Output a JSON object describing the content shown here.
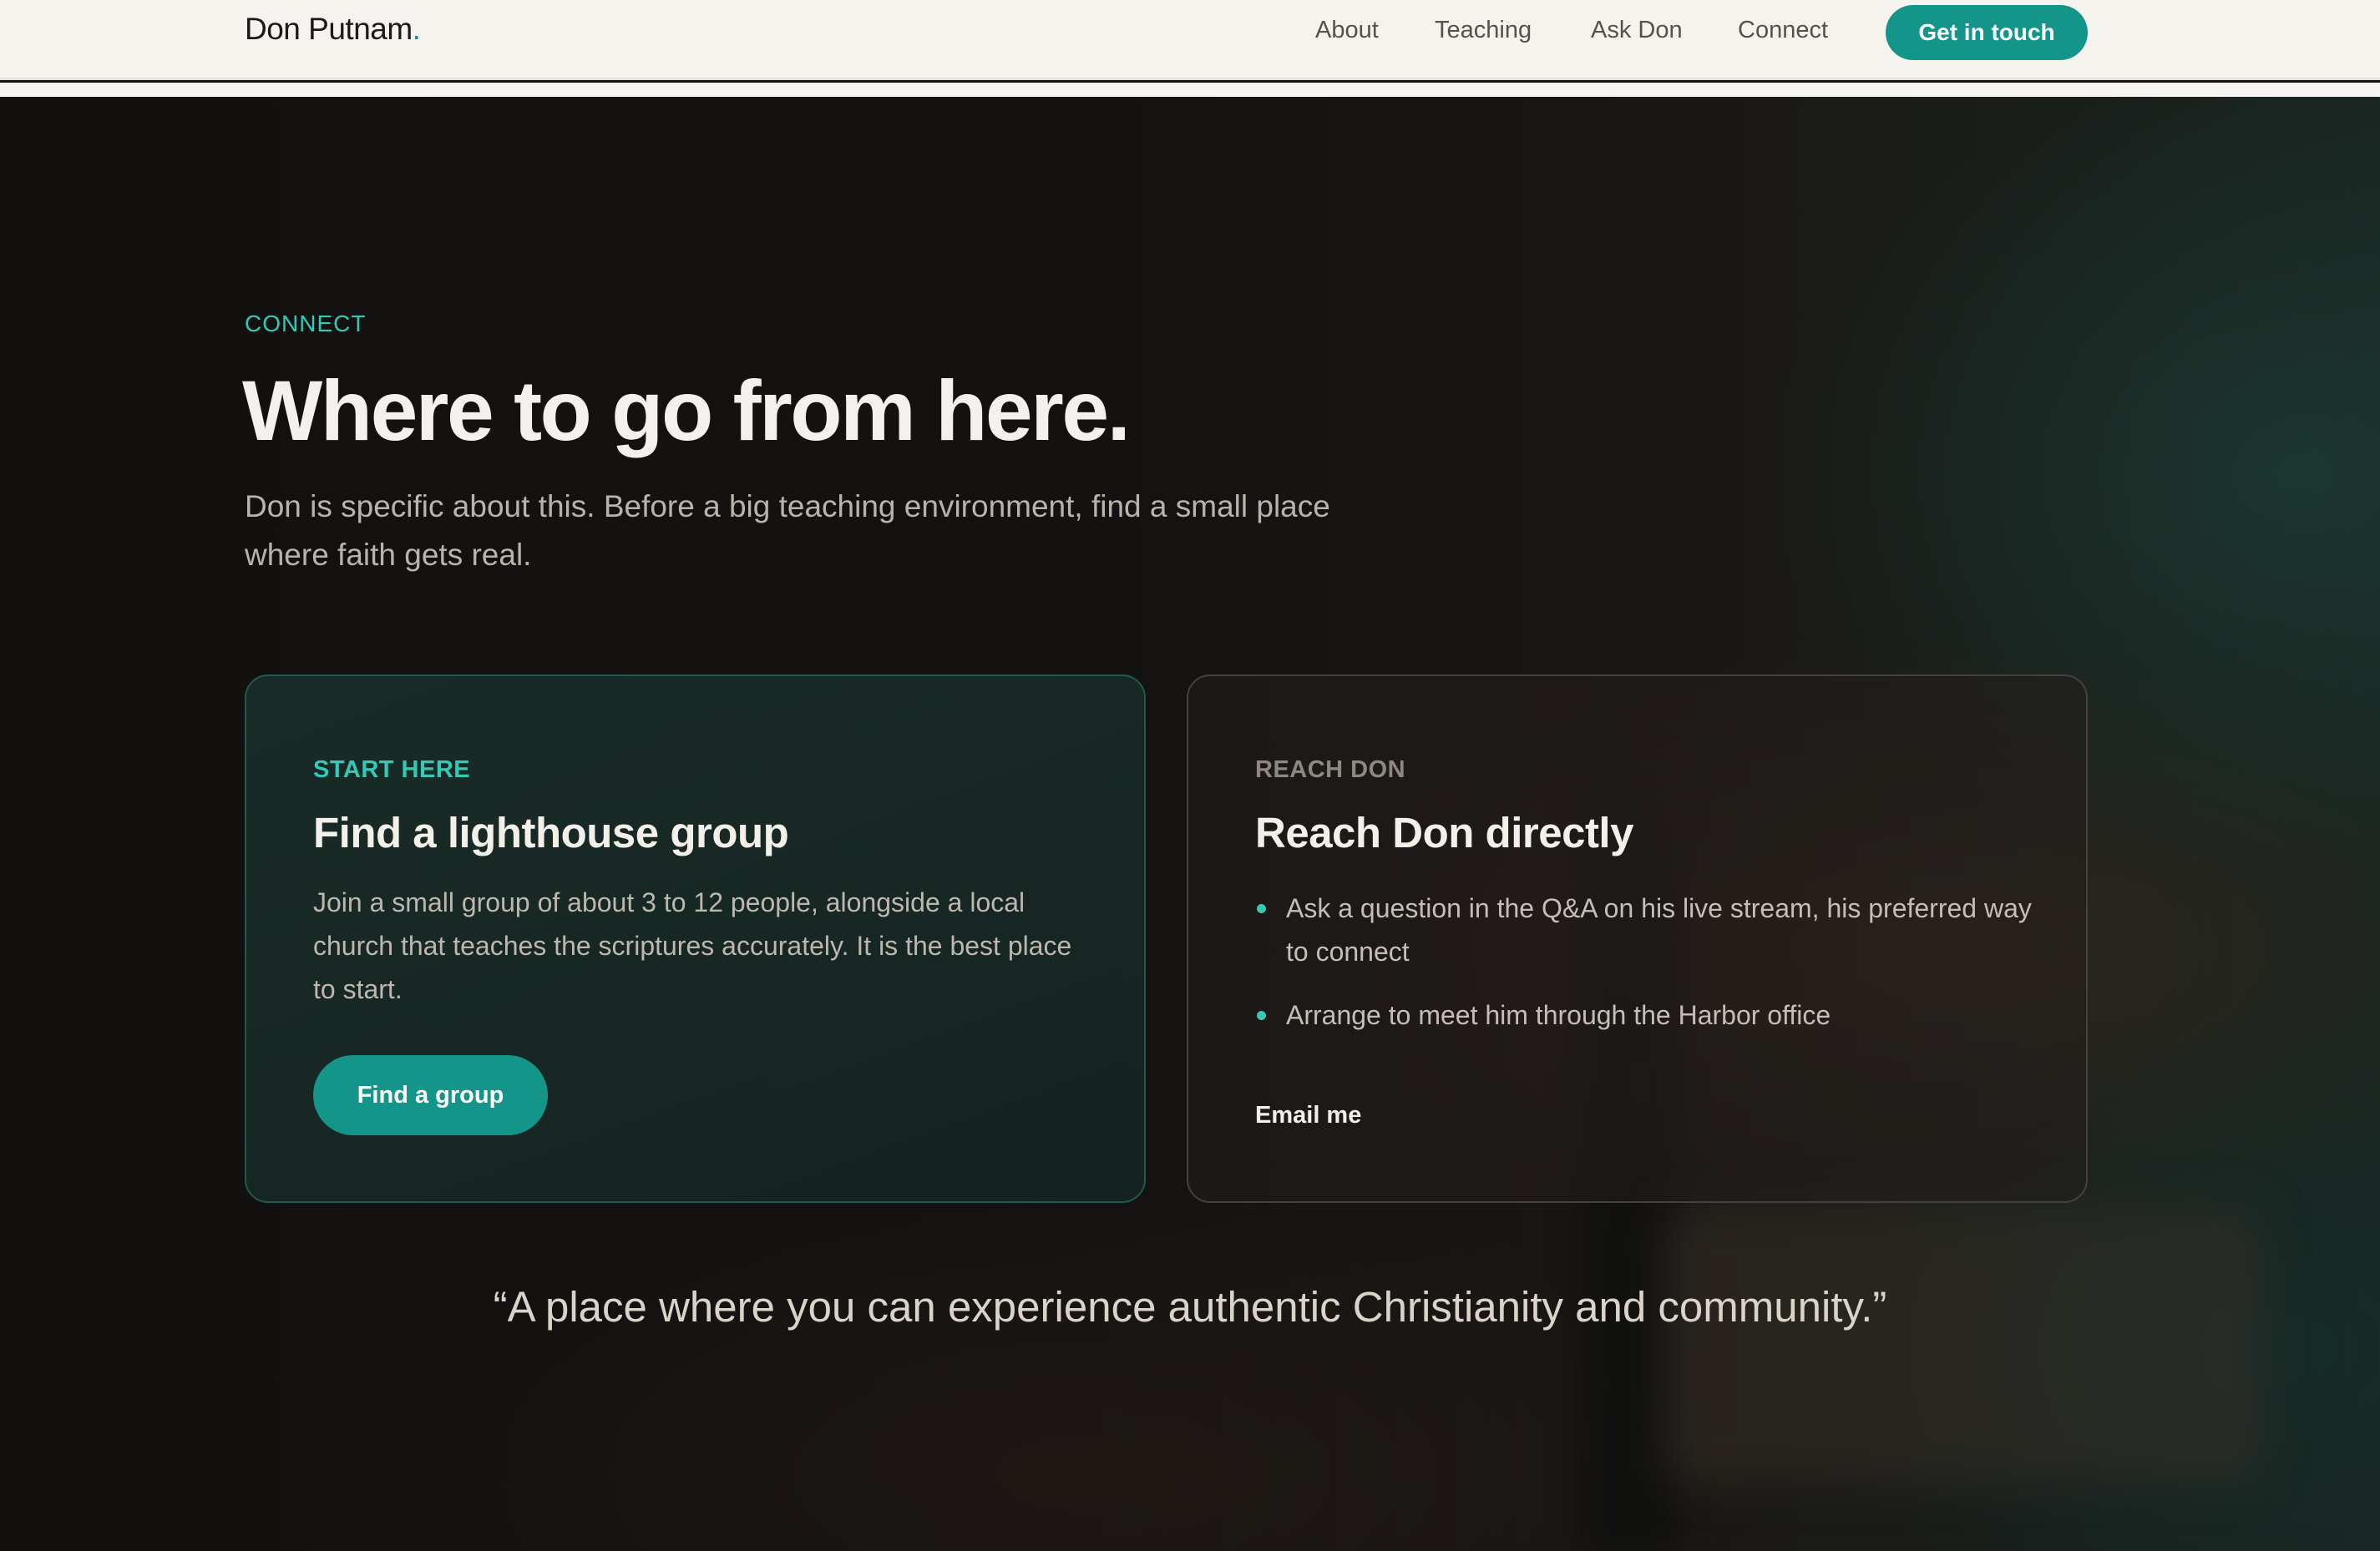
{
  "nav": {
    "brand_name": "Don Putnam",
    "brand_dot": ".",
    "links": [
      {
        "label": "About"
      },
      {
        "label": "Teaching"
      },
      {
        "label": "Ask Don"
      },
      {
        "label": "Connect"
      }
    ],
    "cta_label": "Get in touch"
  },
  "hero": {
    "eyebrow": "CONNECT",
    "title": "Where to go from here.",
    "subtitle": "Don is specific about this. Before a big teaching environment, find a small place where faith gets real."
  },
  "cards": {
    "group": {
      "eyebrow": "START HERE",
      "title": "Find a lighthouse group",
      "body": "Join a small group of about 3 to 12 people, alongside a local church that teaches the scriptures accurately. It is the best place to start.",
      "button_label": "Find a group"
    },
    "reach": {
      "eyebrow": "REACH DON",
      "title": "Reach Don directly",
      "bullets": [
        "Ask a question in the Q&A on his live stream, his preferred way to connect",
        "Arrange to meet him through the Harbor office"
      ],
      "link_label": "Email me"
    }
  },
  "quote": "“A place where you can experience authentic Christianity and community.”",
  "colors": {
    "accent": "#14958a",
    "accent_text": "#34c9b6",
    "nav_background": "#f5f3ee",
    "hero_background": "#141211"
  }
}
